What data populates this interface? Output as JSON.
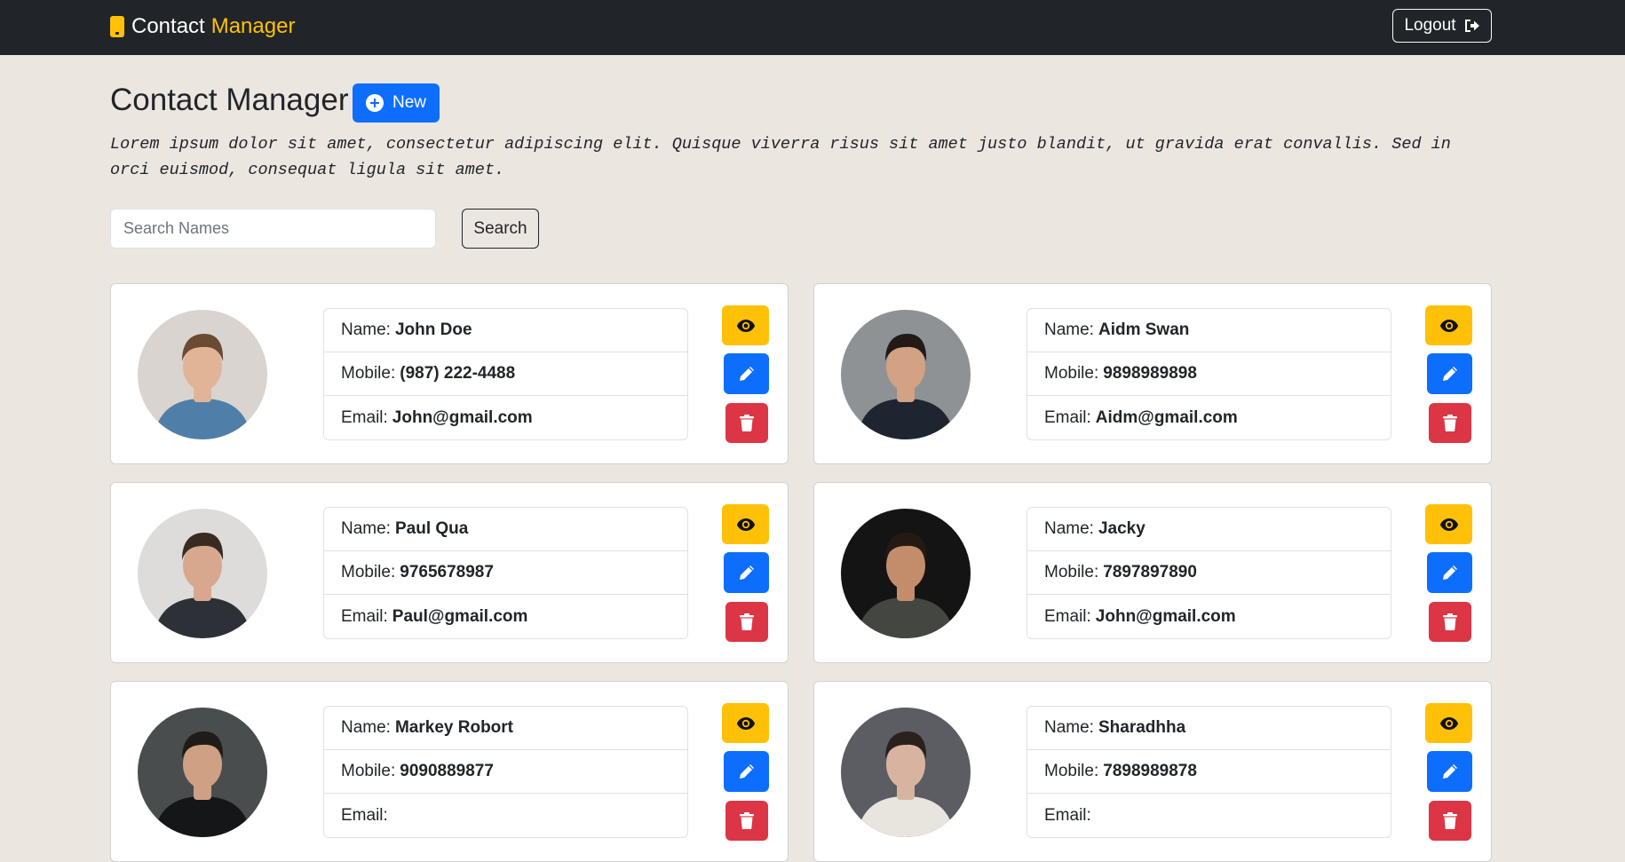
{
  "navbar": {
    "brand_main": "Contact",
    "brand_accent": "Manager",
    "logout_label": "Logout"
  },
  "header": {
    "title": "Contact Manager",
    "new_label": "New",
    "description": "Lorem ipsum dolor sit amet, consectetur adipiscing elit. Quisque viverra risus sit amet justo blandit, ut gravida erat convallis. Sed in orci euismod, consequat ligula sit amet."
  },
  "search": {
    "placeholder": "Search Names",
    "value": "",
    "button_label": "Search"
  },
  "labels": {
    "name": "Name:",
    "mobile": "Mobile:",
    "email": "Email:"
  },
  "contacts": [
    {
      "name": "John Doe",
      "mobile": "(987) 222-4488",
      "email": "John@gmail.com",
      "avatar_bg": "#d9d4cf",
      "avatar_skin": "#e2b497",
      "avatar_shirt": "#4f7fa8",
      "avatar_hair": "#6b4a33"
    },
    {
      "name": "Aidm Swan",
      "mobile": "9898989898",
      "email": "Aidm@gmail.com",
      "avatar_bg": "#8e9294",
      "avatar_skin": "#d3a183",
      "avatar_shirt": "#1e2430",
      "avatar_hair": "#211a16"
    },
    {
      "name": "Paul Qua",
      "mobile": "9765678987",
      "email": "Paul@gmail.com",
      "avatar_bg": "#dddcdb",
      "avatar_skin": "#d7a88d",
      "avatar_shirt": "#2d3036",
      "avatar_hair": "#3a2b22"
    },
    {
      "name": "Jacky",
      "mobile": "7897897890",
      "email": "John@gmail.com",
      "avatar_bg": "#141414",
      "avatar_skin": "#c38d6c",
      "avatar_shirt": "#444641",
      "avatar_hair": "#251a13"
    },
    {
      "name": "Markey Robort",
      "mobile": "9090889877",
      "email": "",
      "avatar_bg": "#4a4d4e",
      "avatar_skin": "#d0a085",
      "avatar_shirt": "#151617",
      "avatar_hair": "#1f1b18"
    },
    {
      "name": "Sharadhha",
      "mobile": "7898989878",
      "email": "",
      "avatar_bg": "#5c5d62",
      "avatar_skin": "#d8b4a0",
      "avatar_shirt": "#e8e4de",
      "avatar_hair": "#2a211d"
    }
  ],
  "icons": {
    "brand": "phone-icon",
    "logout": "sign-out-icon",
    "new": "plus-circle-icon",
    "view": "eye-icon",
    "edit": "pencil-icon",
    "delete": "trash-icon"
  },
  "colors": {
    "navbar": "#212529",
    "accent": "#ffc107",
    "primary": "#0d6efd",
    "danger": "#dc3545",
    "page_bg": "#ece6e1"
  }
}
